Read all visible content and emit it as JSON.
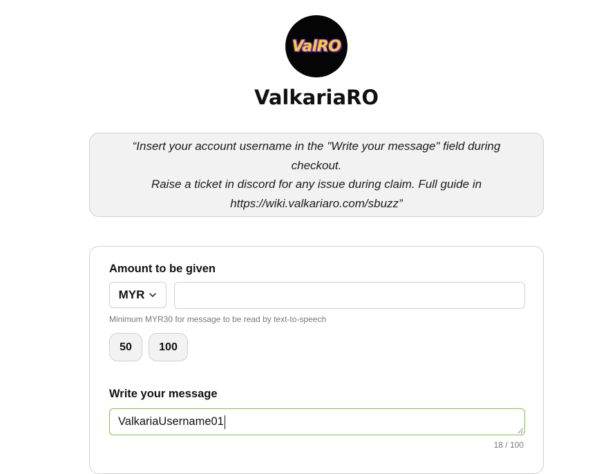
{
  "brand": {
    "logo_text": "ValRO",
    "title": "ValkariaRO"
  },
  "notice": {
    "text": "“Insert your account username in the \"Write your message\" field during checkout.\nRaise a ticket in discord for any issue during claim. Full guide in\nhttps://wiki.valkariaro.com/sbuzz”"
  },
  "form": {
    "amount_label": "Amount to be given",
    "currency": "MYR",
    "amount_value": "",
    "amount_hint": "Minimum MYR30 for message to be read by text-to-speech",
    "presets": [
      "50",
      "100"
    ],
    "message_label": "Write your message",
    "message_value": "ValkariaUsername01",
    "message_counter": "18 / 100"
  },
  "colors": {
    "logo_bg": "#050505",
    "logo_text": "#f4d21f",
    "logo_outline": "#7a2bd6",
    "focus_border": "#7ac03e",
    "notice_bg": "#f2f2f2"
  },
  "icons": {
    "currency_dropdown": "chevron-down-icon",
    "textarea_resize": "resize-grip-icon"
  }
}
